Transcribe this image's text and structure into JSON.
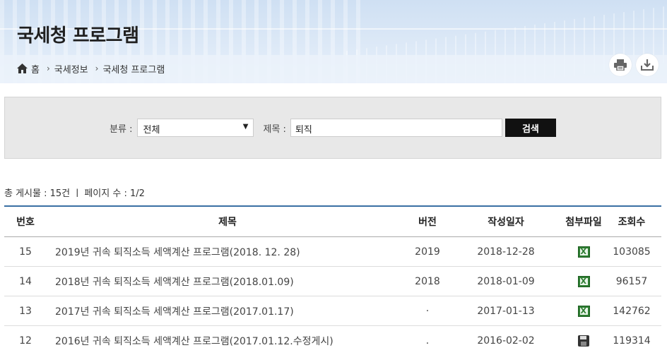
{
  "header": {
    "title": "국세청 프로그램",
    "breadcrumb": [
      "홈",
      "국세정보",
      "국세청 프로그램"
    ],
    "actions": [
      {
        "name": "print",
        "icon": "printer-icon"
      },
      {
        "name": "download",
        "icon": "download-icon"
      }
    ]
  },
  "search": {
    "category_label": "분류 :",
    "category_value": "전체",
    "title_label": "제목 :",
    "title_value": "퇴직",
    "button_label": "검색"
  },
  "summary": {
    "text": "총 게시물 : 15건 ㅣ 페이지 수 : 1/2"
  },
  "table": {
    "headers": [
      "번호",
      "제목",
      "버전",
      "작성일자",
      "첨부파일",
      "조회수"
    ],
    "rows": [
      {
        "no": "15",
        "title": "2019년 귀속 퇴직소득 세액계산 프로그램(2018. 12. 28)",
        "version": "2019",
        "date": "2018-12-28",
        "file_icon": "excel-icon",
        "views": "103085"
      },
      {
        "no": "14",
        "title": "2018년 귀속 퇴직소득 세액계산 프로그램(2018.01.09)",
        "version": "2018",
        "date": "2018-01-09",
        "file_icon": "excel-icon",
        "views": "96157"
      },
      {
        "no": "13",
        "title": "2017년 귀속 퇴직소득 세액계산 프로그램(2017.01.17)",
        "version": "·",
        "date": "2017-01-13",
        "file_icon": "excel-icon",
        "views": "142762"
      },
      {
        "no": "12",
        "title": "2016년 귀속 퇴직소득 세액계산 프로그램(2017.01.12.수정게시)",
        "version": ".",
        "date": "2016-02-02",
        "file_icon": "disk-icon",
        "views": "119314"
      }
    ]
  },
  "colors": {
    "table_top_border": "#3a6fa3",
    "search_button": "#111111",
    "banner": "#cfe0f3"
  }
}
